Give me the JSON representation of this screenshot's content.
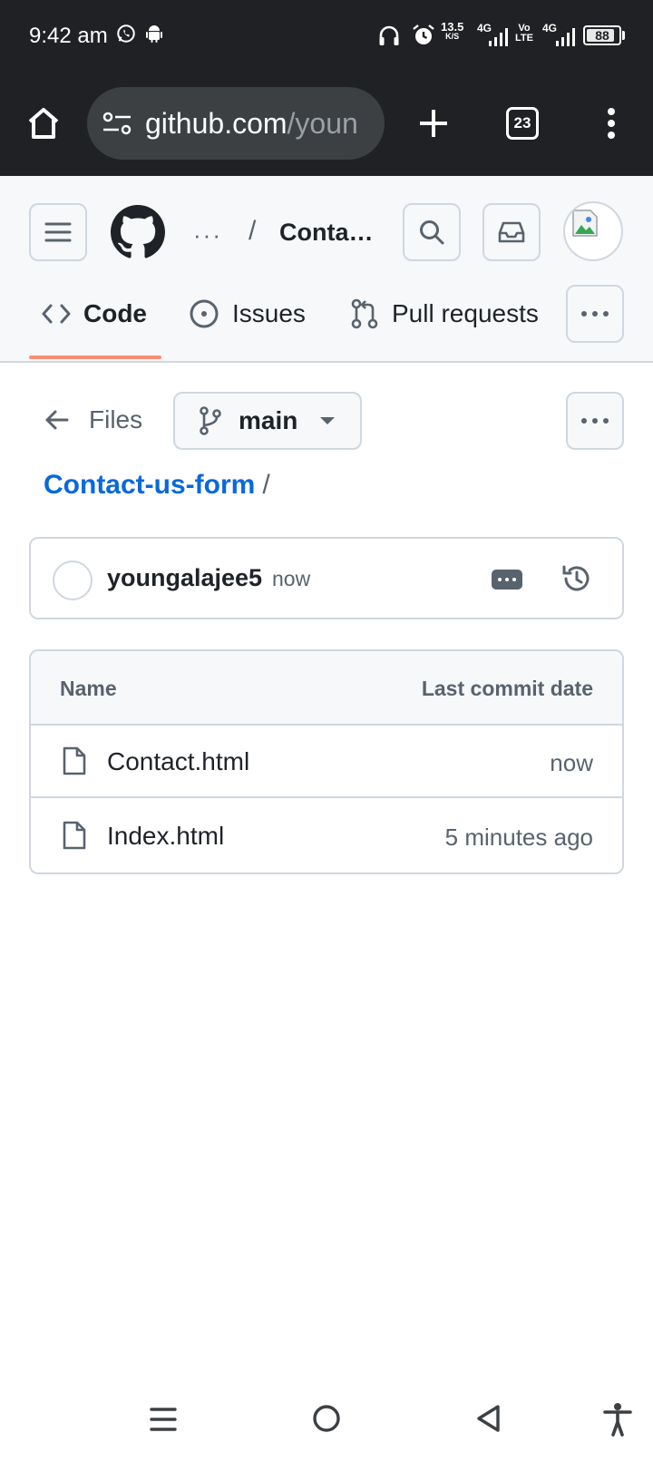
{
  "status_bar": {
    "time": "9:42 am",
    "net_speed_value": "13.5",
    "net_speed_unit": "K/S",
    "net1": "4G",
    "volte_top": "Vo",
    "volte_bottom": "LTE",
    "net2": "4G",
    "battery_level": "88",
    "battery_fraction": 0.88,
    "icons": [
      "whatsapp-icon",
      "android-icon",
      "headphones-icon",
      "alarm-icon",
      "signal-icon",
      "battery-icon"
    ]
  },
  "browser": {
    "url_host": "github.com",
    "url_path": "/youn",
    "tab_count": "23",
    "icons": [
      "home-icon",
      "site-info-icon",
      "new-tab-icon",
      "tab-switcher-icon",
      "menu-icon"
    ]
  },
  "github_header": {
    "breadcrumb_ellipsis": "···",
    "breadcrumb_separator": "/",
    "repo_short": "Conta…",
    "tabs": [
      {
        "label": "Code",
        "icon": "code-icon",
        "active": true
      },
      {
        "label": "Issues",
        "icon": "issue-icon",
        "active": false
      },
      {
        "label": "Pull requests",
        "icon": "pull-request-icon",
        "active": false
      }
    ],
    "accent_color": "#fd8c73"
  },
  "repo_nav": {
    "files_label": "Files",
    "branch": "main"
  },
  "path": {
    "repo_name": "Contact-us-form",
    "separator": "/"
  },
  "latest_commit": {
    "author": "youngalajee5",
    "time": "now"
  },
  "files_table": {
    "headers": {
      "name": "Name",
      "date": "Last commit date"
    },
    "rows": [
      {
        "name": "Contact.html",
        "date": "now",
        "icon": "file-icon"
      },
      {
        "name": "Index.html",
        "date": "5 minutes ago",
        "icon": "file-icon"
      }
    ]
  },
  "colors": {
    "link": "#0969da",
    "muted": "#59636e",
    "border": "#d0d7de",
    "chrome_dark": "#202124"
  }
}
